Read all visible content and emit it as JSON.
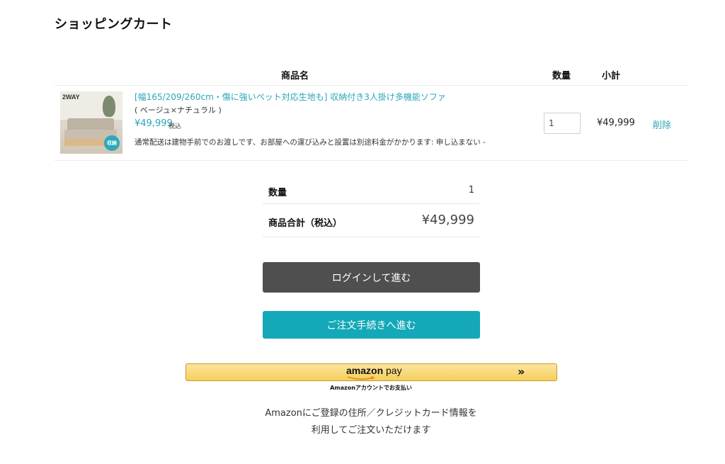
{
  "page": {
    "title": "ショッピングカート"
  },
  "cart": {
    "headers": {
      "name": "商品名",
      "quantity": "数量",
      "subtotal": "小計"
    },
    "item": {
      "thumbnail_label": "2WAY",
      "thumbnail_badge": "収納",
      "name": "[幅165/209/260cm・傷に強いペット対応生地も] 収納付き3人掛け多機能ソファ",
      "variant": "( ベージュ×ナチュラル )",
      "price": "¥49,999",
      "tax_label": "税込",
      "note": "通常配送は建物手前でのお渡しです、お部屋への運び込みと設置は別途料金がかかります: 申し込まない -",
      "quantity": "1",
      "subtotal": "¥49,999",
      "delete_label": "削除"
    }
  },
  "summary": {
    "quantity_label": "数量",
    "quantity_value": "1",
    "total_label": "商品合計（税込）",
    "total_value": "¥49,999"
  },
  "buttons": {
    "login": "ログインして進む",
    "checkout": "ご注文手続きへ進む"
  },
  "amazon_pay": {
    "logo_amazon": "amazon",
    "logo_pay": "pay",
    "chevron": "»",
    "sub_label": "Amazonアカウントでお支払い",
    "desc_line1": "Amazonにご登録の住所／クレジットカード情報を",
    "desc_line2": "利用してご注文いただけます"
  },
  "colors": {
    "accent": "#14a8b8",
    "link": "#2aa6b8",
    "login_button": "#4f4f4f",
    "amazon_yellow": "#f5cf5c"
  }
}
